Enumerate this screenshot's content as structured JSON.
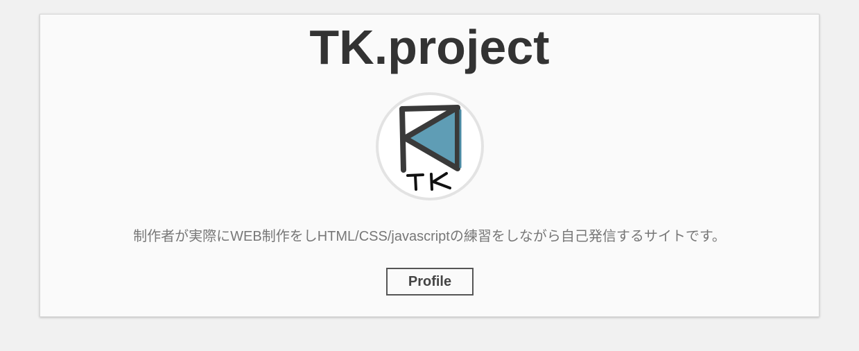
{
  "header": {
    "title": "TK.project"
  },
  "logo": {
    "icon": "tk-triangle-logo-icon",
    "text": "TK",
    "accent_color": "#5f9db5",
    "stroke_color": "#3a3a3a"
  },
  "main": {
    "description": "制作者が実際にWEB制作をしHTML/CSS/javascriptの練習をしながら自己発信するサイトです。",
    "profile_button_label": "Profile"
  },
  "colors": {
    "page_background": "#f1f1f1",
    "card_background": "#fafafa",
    "title_text": "#333333",
    "body_text": "#777777",
    "button_border": "#555555"
  }
}
